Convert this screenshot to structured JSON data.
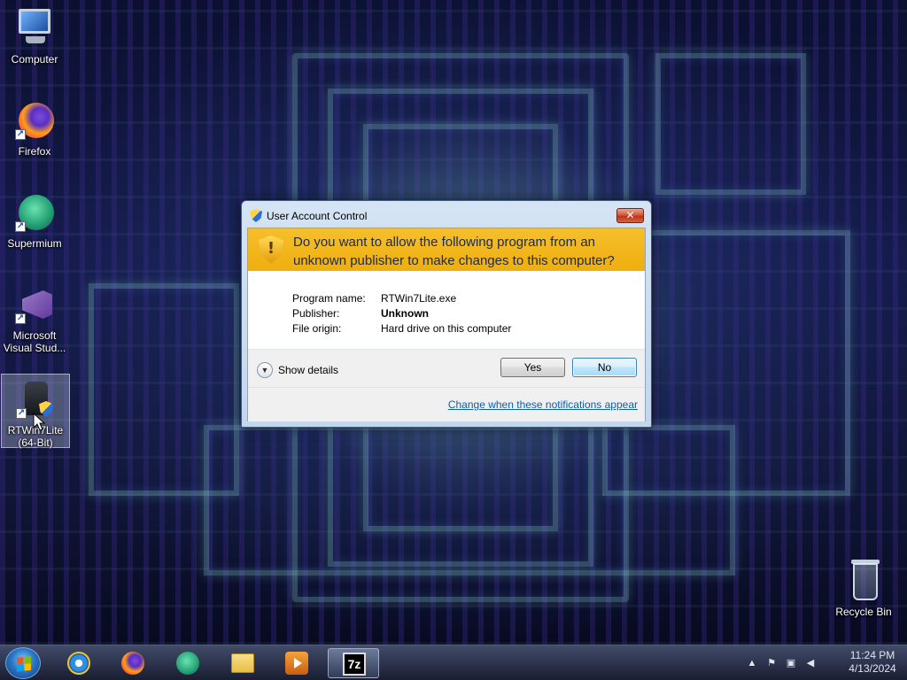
{
  "desktop": {
    "icons": [
      {
        "label": "Computer"
      },
      {
        "label": "Firefox"
      },
      {
        "label": "Supermium"
      },
      {
        "label": "Microsoft Visual Stud..."
      },
      {
        "label": "RTWin7Lite (64-Bit)"
      },
      {
        "label": "Recycle Bin"
      }
    ]
  },
  "uac": {
    "title": "User Account Control",
    "close_label": "✕",
    "question": "Do you want to allow the following program from an unknown publisher to make changes to this computer?",
    "details": [
      {
        "label": "Program name:",
        "value": "RTWin7Lite.exe"
      },
      {
        "label": "Publisher:",
        "value": "Unknown"
      },
      {
        "label": "File origin:",
        "value": "Hard drive on this computer"
      }
    ],
    "show_details_label": "Show details",
    "yes_label": "Yes",
    "no_label": "No",
    "change_link": "Change when these notifications appear"
  },
  "taskbar": {
    "pinned": [
      {
        "icon": "internet-explorer-icon"
      },
      {
        "icon": "firefox-icon"
      },
      {
        "icon": "supermium-icon"
      },
      {
        "icon": "file-explorer-icon"
      },
      {
        "icon": "media-player-icon"
      },
      {
        "icon": "7zip-icon",
        "text": "7z"
      }
    ],
    "clock": {
      "time": "11:24 PM",
      "date": "4/13/2024"
    }
  },
  "colors": {
    "uac_header": "#efaf0e",
    "link": "#0b5fb5",
    "close_button": "#c03417"
  }
}
